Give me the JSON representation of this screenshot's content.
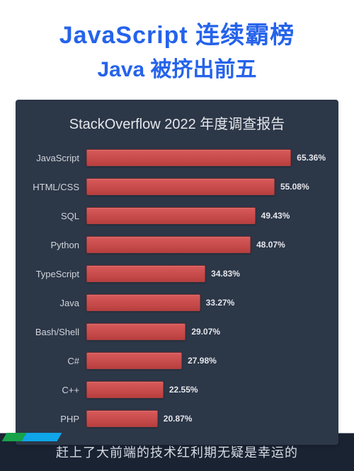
{
  "header": {
    "line1": "JavaScript 连续霸榜",
    "line2": "Java 被挤出前五"
  },
  "chart_data": {
    "type": "bar",
    "title": "StackOverflow 2022 年度调查报告",
    "xlabel": "",
    "ylabel": "",
    "xlim": [
      0,
      70
    ],
    "categories": [
      "JavaScript",
      "HTML/CSS",
      "SQL",
      "Python",
      "TypeScript",
      "Java",
      "Bash/Shell",
      "C#",
      "C++",
      "PHP"
    ],
    "values": [
      65.36,
      55.08,
      49.43,
      48.07,
      34.83,
      33.27,
      29.07,
      27.98,
      22.55,
      20.87
    ],
    "value_labels": [
      "65.36%",
      "55.08%",
      "49.43%",
      "48.07%",
      "34.83%",
      "33.27%",
      "29.07%",
      "27.98%",
      "22.55%",
      "20.87%"
    ],
    "bar_color": "#c74c4c",
    "panel_bg": "#2c3748"
  },
  "footer": {
    "caption": "赶上了大前端的技术红利期无疑是幸运的"
  }
}
